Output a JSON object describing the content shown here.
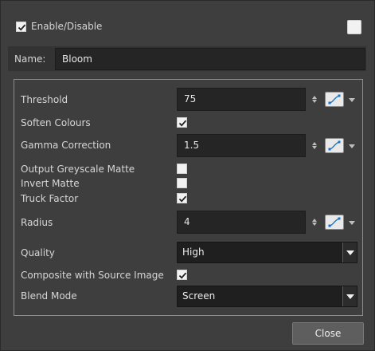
{
  "header": {
    "enable_label": "Enable/Disable",
    "enabled": true
  },
  "name_field": {
    "label": "Name:",
    "value": "Bloom"
  },
  "params": {
    "threshold": {
      "label": "Threshold",
      "value": "75"
    },
    "soften_colours": {
      "label": "Soften Colours",
      "checked": true
    },
    "gamma_correction": {
      "label": "Gamma Correction",
      "value": "1.5"
    },
    "output_greyscale_matte": {
      "label": "Output Greyscale Matte",
      "checked": false
    },
    "invert_matte": {
      "label": "Invert Matte",
      "checked": false
    },
    "truck_factor": {
      "label": "Truck Factor",
      "checked": true
    },
    "radius": {
      "label": "Radius",
      "value": "4"
    },
    "quality": {
      "label": "Quality",
      "value": "High"
    },
    "composite_with_source_image": {
      "label": "Composite with Source Image",
      "checked": true
    },
    "blend_mode": {
      "label": "Blend Mode",
      "value": "Screen"
    }
  },
  "footer": {
    "close_label": "Close"
  },
  "icons": {
    "function": "function-curve-icon",
    "spinner": "spinner-arrows-icon",
    "caret": "chevron-down-icon",
    "check": "checkmark-icon"
  },
  "colors": {
    "background": "#3e3e3e",
    "field_bg": "#252525",
    "dropdown_bg": "#1f1f1f",
    "function_accent": "#1a73c8"
  }
}
